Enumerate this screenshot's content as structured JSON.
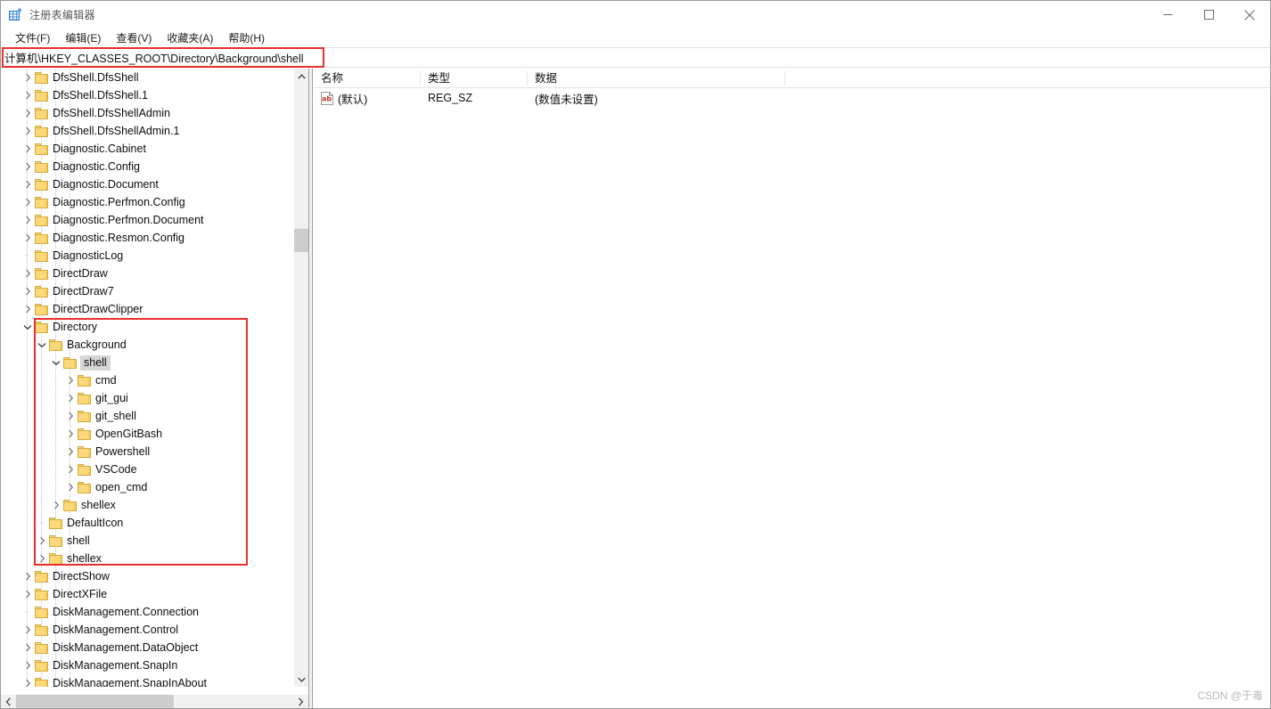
{
  "window": {
    "title": "注册表编辑器",
    "app_icon": "registry-grid-icon",
    "minimize_label": "—",
    "maximize_label": "□",
    "close_label": "✕"
  },
  "menu": {
    "items": [
      {
        "label": "文件(F)"
      },
      {
        "label": "编辑(E)"
      },
      {
        "label": "查看(V)"
      },
      {
        "label": "收藏夹(A)"
      },
      {
        "label": "帮助(H)"
      }
    ]
  },
  "address": {
    "value": "计算机\\HKEY_CLASSES_ROOT\\Directory\\Background\\shell",
    "placeholder": "",
    "highlight_color": "#e8302b"
  },
  "tree": {
    "selected": "shell",
    "highlight_color": "#e8302b",
    "nodes": [
      {
        "label": "DfsShell.DfsShell",
        "depth": 1,
        "expander": "collapsed"
      },
      {
        "label": "DfsShell.DfsShell.1",
        "depth": 1,
        "expander": "collapsed"
      },
      {
        "label": "DfsShell.DfsShellAdmin",
        "depth": 1,
        "expander": "collapsed"
      },
      {
        "label": "DfsShell.DfsShellAdmin.1",
        "depth": 1,
        "expander": "collapsed"
      },
      {
        "label": "Diagnostic.Cabinet",
        "depth": 1,
        "expander": "collapsed"
      },
      {
        "label": "Diagnostic.Config",
        "depth": 1,
        "expander": "collapsed"
      },
      {
        "label": "Diagnostic.Document",
        "depth": 1,
        "expander": "collapsed"
      },
      {
        "label": "Diagnostic.Perfmon.Config",
        "depth": 1,
        "expander": "collapsed"
      },
      {
        "label": "Diagnostic.Perfmon.Document",
        "depth": 1,
        "expander": "collapsed"
      },
      {
        "label": "Diagnostic.Resmon.Config",
        "depth": 1,
        "expander": "collapsed"
      },
      {
        "label": "DiagnosticLog",
        "depth": 1,
        "expander": "none"
      },
      {
        "label": "DirectDraw",
        "depth": 1,
        "expander": "collapsed"
      },
      {
        "label": "DirectDraw7",
        "depth": 1,
        "expander": "collapsed"
      },
      {
        "label": "DirectDrawClipper",
        "depth": 1,
        "expander": "collapsed"
      },
      {
        "label": "Directory",
        "depth": 1,
        "expander": "expanded"
      },
      {
        "label": "Background",
        "depth": 2,
        "expander": "expanded"
      },
      {
        "label": "shell",
        "depth": 3,
        "expander": "expanded",
        "selected": true
      },
      {
        "label": "cmd",
        "depth": 4,
        "expander": "collapsed"
      },
      {
        "label": "git_gui",
        "depth": 4,
        "expander": "collapsed"
      },
      {
        "label": "git_shell",
        "depth": 4,
        "expander": "collapsed"
      },
      {
        "label": "OpenGitBash",
        "depth": 4,
        "expander": "collapsed"
      },
      {
        "label": "Powershell",
        "depth": 4,
        "expander": "collapsed"
      },
      {
        "label": "VSCode",
        "depth": 4,
        "expander": "collapsed"
      },
      {
        "label": "open_cmd",
        "depth": 4,
        "expander": "collapsed"
      },
      {
        "label": "shellex",
        "depth": 3,
        "expander": "collapsed"
      },
      {
        "label": "DefaultIcon",
        "depth": 2,
        "expander": "none"
      },
      {
        "label": "shell",
        "depth": 2,
        "expander": "collapsed"
      },
      {
        "label": "shellex",
        "depth": 2,
        "expander": "collapsed"
      },
      {
        "label": "DirectShow",
        "depth": 1,
        "expander": "collapsed"
      },
      {
        "label": "DirectXFile",
        "depth": 1,
        "expander": "collapsed"
      },
      {
        "label": "DiskManagement.Connection",
        "depth": 1,
        "expander": "none"
      },
      {
        "label": "DiskManagement.Control",
        "depth": 1,
        "expander": "collapsed"
      },
      {
        "label": "DiskManagement.DataObject",
        "depth": 1,
        "expander": "collapsed"
      },
      {
        "label": "DiskManagement.SnapIn",
        "depth": 1,
        "expander": "collapsed"
      },
      {
        "label": "DiskManagement.SnapInAbout",
        "depth": 1,
        "expander": "collapsed"
      }
    ]
  },
  "values_list": {
    "columns": [
      "名称",
      "类型",
      "数据"
    ],
    "rows": [
      {
        "icon": "ab-string-value-icon",
        "name": "(默认)",
        "type": "REG_SZ",
        "data": "(数值未设置)"
      }
    ]
  },
  "watermark": {
    "text": "CSDN @于毒"
  }
}
